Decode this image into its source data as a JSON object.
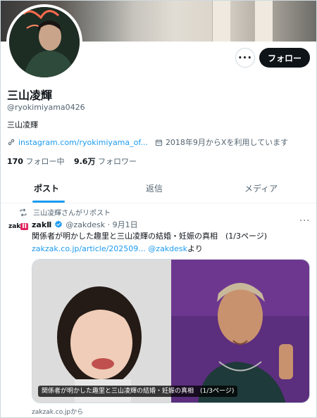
{
  "profile": {
    "name": "三山凌輝",
    "handle": "@ryokimiyama0426",
    "bio": "三山凌輝",
    "link": "instagram.com/ryokimiyama_of...",
    "joined": "2018年9月からXを利用しています",
    "following_count": "170",
    "following_label": "フォロー中",
    "followers_count": "9.6万",
    "followers_label": "フォロワー"
  },
  "actions": {
    "more_label": "···",
    "follow_label": "フォロー"
  },
  "tabs": [
    {
      "label": "ポスト",
      "active": true
    },
    {
      "label": "返信",
      "active": false
    },
    {
      "label": "メディア",
      "active": false
    }
  ],
  "post": {
    "repost_label": "三山凌輝さんがリポスト",
    "author_logo": "zak",
    "author_logo_badge": "II",
    "author_name": "zakⅡ",
    "author_handle": "@zakdesk",
    "date": "9月1日",
    "text": "関係者が明かした趣里と三山凌輝の結婚・妊娠の真相　(1/3ページ)",
    "link": "zakzak.co.jp/article/202509...",
    "mention": "@zakdesk",
    "link_suffix": "より",
    "image_caption": "関係者が明かした趣里と三山凌輝の結婚・妊娠の真相　(1/3ページ)",
    "source": "zakzak.co.jpから",
    "more_label": "···"
  },
  "icons": {
    "link": "link-icon",
    "calendar": "calendar-icon",
    "repost": "repost-icon",
    "verified": "verified-badge-icon"
  },
  "colors": {
    "accent": "#1d9bf0",
    "text": "#0f1419",
    "muted": "#536471",
    "follow_button": "#0f1419",
    "logo_red": "#e0245e"
  }
}
